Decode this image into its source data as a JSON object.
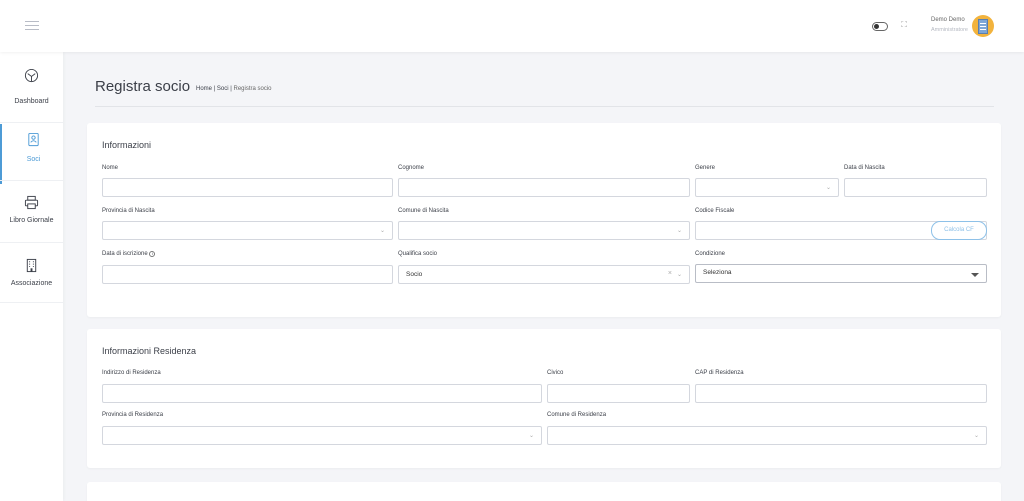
{
  "header": {
    "user_name": "Demo Demo",
    "user_role": "Amministratore"
  },
  "sidebar": {
    "items": [
      {
        "label": "Dashboard",
        "icon": "dashboard-icon"
      },
      {
        "label": "Soci",
        "icon": "member-card-icon",
        "active": true
      },
      {
        "label": "Libro Giornale",
        "icon": "printer-icon"
      },
      {
        "label": "Associazione",
        "icon": "building-icon"
      }
    ]
  },
  "page": {
    "title": "Registra socio",
    "breadcrumb": {
      "home": "Home",
      "sep": "|",
      "soci": "Soci",
      "current": "Registra socio"
    }
  },
  "informazioni": {
    "title": "Informazioni",
    "nome_label": "Nome",
    "cognome_label": "Cognome",
    "genere_label": "Genere",
    "data_nascita_label": "Data di Nascita",
    "provincia_nascita_label": "Provincia di Nascita",
    "comune_nascita_label": "Comune di Nascita",
    "codice_fiscale_label": "Codice Fiscale",
    "calcola_cf_label": "Calcola CF",
    "data_iscrizione_label": "Data di iscrizione",
    "qualifica_label": "Qualifica socio",
    "qualifica_value": "Socio",
    "condizione_label": "Condizione",
    "condizione_value": "Seleziona"
  },
  "residenza": {
    "title": "Informazioni Residenza",
    "indirizzo_label": "Indirizzo di Residenza",
    "civico_label": "Civico",
    "cap_label": "CAP di Residenza",
    "provincia_label": "Provincia di Residenza",
    "comune_label": "Comune di Residenza"
  },
  "colors": {
    "accent": "#4d9bd6",
    "background": "#f4f5f8"
  }
}
